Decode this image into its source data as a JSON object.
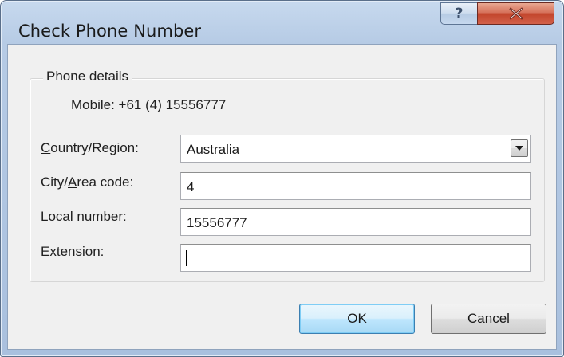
{
  "window": {
    "title": "Check Phone Number",
    "help_glyph": "?",
    "close_icon": "close-x-icon"
  },
  "group": {
    "label": "Phone details",
    "summary": "Mobile: +61 (4) 15556777"
  },
  "fields": {
    "country": {
      "label": "Country/Region:",
      "access_key": "C",
      "value": "Australia"
    },
    "city": {
      "label": "City/Area code:",
      "access_key": "A",
      "value": "4"
    },
    "local": {
      "label": "Local number:",
      "access_key": "L",
      "value": "15556777"
    },
    "extension": {
      "label": "Extension:",
      "access_key": "E",
      "value": ""
    }
  },
  "buttons": {
    "ok": "OK",
    "cancel": "Cancel"
  },
  "colors": {
    "title_bar": "#b6cbe5",
    "close_button": "#c2452c",
    "dialog_face": "#f0f0f0",
    "default_button_border": "#3c7fb1"
  }
}
